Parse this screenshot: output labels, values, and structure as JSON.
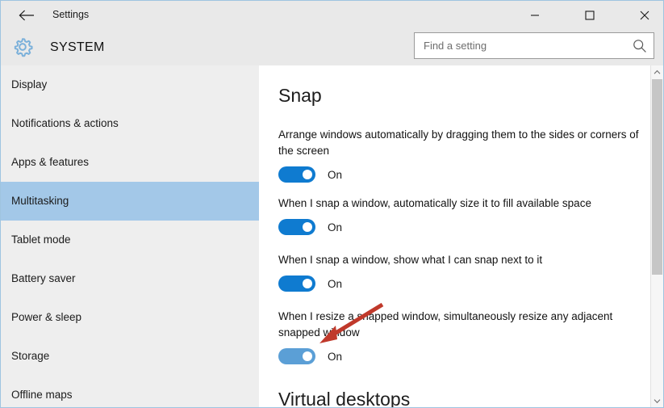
{
  "window": {
    "title": "Settings",
    "back_icon": "back-arrow-icon",
    "minimize_label": "—",
    "maximize_label": "☐",
    "close_label": "✕"
  },
  "header": {
    "page_title": "SYSTEM",
    "gear_icon": "gear-icon",
    "accent_color": "#0f7bd0"
  },
  "search": {
    "value": "",
    "placeholder": "Find a setting",
    "icon": "search-icon"
  },
  "sidebar": {
    "selected_index": 3,
    "selected_color": "#a3c8e8",
    "items": [
      {
        "label": "Display"
      },
      {
        "label": "Notifications & actions"
      },
      {
        "label": "Apps & features"
      },
      {
        "label": "Multitasking"
      },
      {
        "label": "Tablet mode"
      },
      {
        "label": "Battery saver"
      },
      {
        "label": "Power & sleep"
      },
      {
        "label": "Storage"
      },
      {
        "label": "Offline maps"
      }
    ]
  },
  "content": {
    "section_title": "Snap",
    "next_section_title": "Virtual desktops",
    "settings": [
      {
        "label": "Arrange windows automatically by dragging them to the sides or corners of the screen",
        "state": "On",
        "toggle_on": true,
        "hovered": false
      },
      {
        "label": "When I snap a window, automatically size it to fill available space",
        "state": "On",
        "toggle_on": true,
        "hovered": false
      },
      {
        "label": "When I snap a window, show what I can snap next to it",
        "state": "On",
        "toggle_on": true,
        "hovered": false
      },
      {
        "label": "When I resize a snapped window, simultaneously resize any adjacent snapped window",
        "state": "On",
        "toggle_on": true,
        "hovered": true
      }
    ]
  },
  "annotation": {
    "type": "arrow",
    "color": "#c0392b",
    "points_at": "resize-adjacent-snapped-window-toggle"
  },
  "scrollbar": {
    "up_icon": "chevron-up-icon",
    "down_icon": "chevron-down-icon"
  }
}
